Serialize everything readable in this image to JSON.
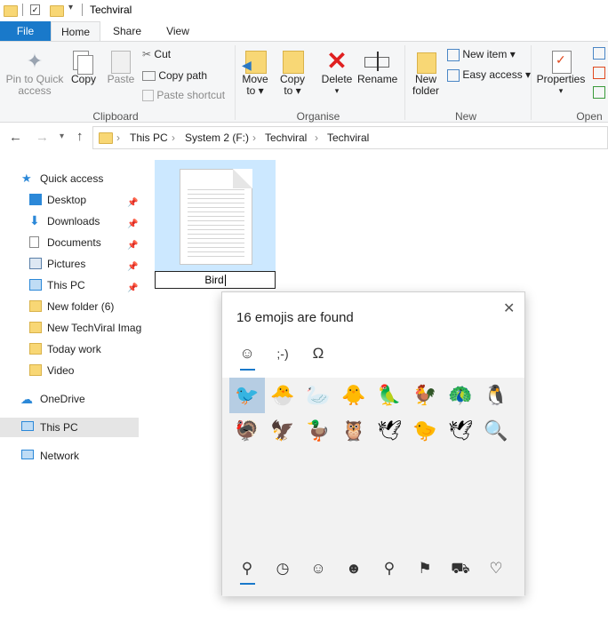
{
  "window": {
    "title": "Techviral"
  },
  "tabs": {
    "file": "File",
    "home": "Home",
    "share": "Share",
    "view": "View"
  },
  "ribbon": {
    "pin_to_quick_access": [
      "Pin to Quick",
      "access"
    ],
    "copy": "Copy",
    "paste": "Paste",
    "cut": "Cut",
    "copy_path": "Copy path",
    "paste_shortcut": "Paste shortcut",
    "clipboard": "Clipboard",
    "move_to": [
      "Move",
      "to"
    ],
    "copy_to": [
      "Copy",
      "to"
    ],
    "delete": "Delete",
    "rename": "Rename",
    "organise": "Organise",
    "new_folder": [
      "New",
      "folder"
    ],
    "new_item": "New item",
    "easy_access": "Easy access",
    "new": "New",
    "properties": "Properties",
    "open": "Open"
  },
  "breadcrumb": [
    "This PC",
    "System 2 (F:)",
    "Techviral",
    "Techviral"
  ],
  "sidebar": {
    "quick_access": "Quick access",
    "items": [
      "Desktop",
      "Downloads",
      "Documents",
      "Pictures",
      "This PC",
      "New folder (6)",
      "New TechViral Imag",
      "Today work",
      "Video"
    ],
    "onedrive": "OneDrive",
    "this_pc": "This PC",
    "network": "Network"
  },
  "file": {
    "rename_value": "Bird"
  },
  "emoji_panel": {
    "title": "16 emojis are found",
    "tabs": [
      "☺",
      ";-)",
      "Ω"
    ],
    "emojis": [
      "🐦",
      "🐣",
      "🦢",
      "🐥",
      "🦜",
      "🐓",
      "🦚",
      "🐧",
      "🦃",
      "🦅",
      "🦆",
      "🦉",
      "🕊",
      "🐤",
      "🕊",
      "🔍"
    ],
    "categories": [
      "search",
      "recent",
      "smiley",
      "people",
      "places",
      "celebration",
      "transport",
      "heart"
    ]
  },
  "colors": {
    "accent": "#1979ca",
    "selection": "#cce8ff",
    "ribbon_bg": "#f5f6f7"
  }
}
